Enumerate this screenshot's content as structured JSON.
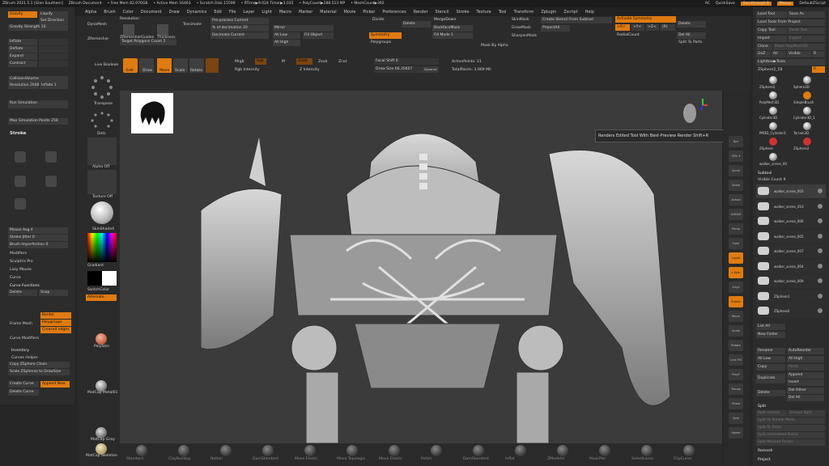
{
  "title_bar": {
    "app": "ZBrush 2021.5.1 [Glen Southern]",
    "doc": "ZBrush Document",
    "free_mem": "• Free Mem 82.076GB",
    "active_mem": "• Active Mem 16463",
    "scratch": "• Scratch Disk 15599",
    "ztime": "• RTime▶9.024 Timer▶3.035",
    "poly": "• PolyCount▶288.513 MP",
    "mesh": "• MeshCount▶392",
    "ac": "AC",
    "quicksave": "QuickSave",
    "seethrough": "See-through 0",
    "menus": "Menus",
    "script": "DefaultZScript"
  },
  "menu": [
    "Alpha",
    "Brush",
    "Color",
    "Document",
    "Draw",
    "Dynamics",
    "Edit",
    "File",
    "Layer",
    "Light",
    "Macro",
    "Marker",
    "Material",
    "Movie",
    "Picker",
    "Preferences",
    "Render",
    "Stencil",
    "Stroke",
    "Texture",
    "Tool",
    "Transform",
    "Zplugin",
    "Zscript",
    "Help"
  ],
  "left_top": {
    "gravity": "Gravity",
    "liquify": "Liquify",
    "set_direction": "Set Direction",
    "gravity_strength": "Gravity Strength 10",
    "inflate": "Inflate",
    "deflate": "Deflate",
    "expand": "Expand",
    "contract": "Contract",
    "collision_volume": "CollisionVolume",
    "resolution": "Resolution 2048",
    "inflate1": "Inflate 1",
    "run_sim": "Run Simulation",
    "max_points": "Max Simulation Points 250"
  },
  "stroke": {
    "header": "Stroke",
    "mouse_avg": "Mouse Avg 4",
    "stroke_jitter": "Stroke Jitter 0",
    "brush_imp": "Brush Imperfection 0",
    "modifiers": "Modifiers",
    "sculptris": "Sculptris Pro",
    "lazy": "Lazy Mouse",
    "curve": "Curve",
    "curve_functions": "Curve Functions",
    "delete": "Delete",
    "snap": "Snap",
    "border": "Border",
    "polygroups": "Polygroups",
    "creased": "Creased edges",
    "frame_mesh": "Frame Mesh",
    "curve_mod": "Curve Modifiers",
    "inventory": "Inventory",
    "curves_helper": "Curves Helper",
    "copy_chain": "Copy ZSphere Chain",
    "scale_draw": "Scale ZSpheres to DrawSize",
    "create_curve": "Create Curve",
    "append_new": "Append New",
    "delete_curve": "Delete Curve"
  },
  "left_col": {
    "live_boolean": "Live Boolean",
    "transpose": "Transpose",
    "dots": "Dots",
    "alpha_off": "Alpha Off",
    "texture_off": "Texture Off",
    "skinshade": "SkinShade4",
    "gradient": "Gradient",
    "switchcolor": "SwitchColor",
    "alternate": "Alternate",
    "polyskin": "PolySkin",
    "matcap_metal": "MatCap Metal01",
    "matcap_gray": "MatCap Gray",
    "matcap_skeleton": "MatCap Skeleton"
  },
  "top_shelf": {
    "dynamesh": "DynaMesh",
    "zremesher": "ZRemesher",
    "resolution": "Resolution",
    "zremeshguides": "ZRemesherGuides",
    "thickness": "Thickness",
    "tessimate": "Tessimate",
    "preprocess": "Pre-process Current",
    "pct_decimation": "% of decimation 20",
    "decimate": "Decimate Current",
    "target_poly": "Target Polygons Count 5",
    "mirror": "Mirror",
    "all_low": "All Low",
    "all_high": "All High",
    "fill_object": "Fill Object",
    "divide": "Divide",
    "delete": "Delete",
    "merge_down": "MergeDown",
    "backface": "BackfaceMask",
    "fill_mode": "Fill Mode 1",
    "projection": "ProjectAll",
    "symmetry": "Symmetry",
    "polygroups": "Polygroups",
    "mask_by_alpha": "Mask By Alpha",
    "skinmask": "SkinMask",
    "growmask": "GrowMask",
    "sharpenmask": "SharpenMask",
    "create_stencil": "Create Stencil From Subtool",
    "activate_sym": "Activate Symmetry",
    "x": ">X<",
    "y": ">Y<",
    "z": ">Z<",
    "r": "(R)",
    "radial": "RadialCount",
    "del_all": "Del All",
    "split_to_parts": "Split To Parts",
    "edit": "Edit",
    "draw": "Draw",
    "move": "Move",
    "scale": "Scale",
    "rotate": "Rotate",
    "mrgb": "Mrgb",
    "rgb": "Rgb",
    "m": "M",
    "zadd": "Zadd",
    "zsub": "Zsub",
    "zcut": "Zcut",
    "rgb_intensity": "Rgb Intensity",
    "z_intensity": "Z Intensity",
    "focal_shift": "Focal Shift 0",
    "draw_size": "Draw Size 66.35607",
    "dynamic": "Dynamic",
    "active_points": "ActivePoints: 21",
    "total_points": "TotalPoints: 3.969 Mil"
  },
  "tooltip": "Renders Edited Tool With Best-Preview Render  Shift+R",
  "right_tool": {
    "load_tool": "Load Tool",
    "save_as": "Save As",
    "load_from_project": "Load Tools From Project",
    "copy_tool": "Copy Tool",
    "paste_tool": "Paste Tool",
    "import": "Import",
    "export": "Export",
    "clone": "Clone",
    "make_polymesh": "Make PolyMesh3D",
    "goz": "GoZ",
    "all": "All",
    "visible": "Visible",
    "r": "R",
    "lightbox_tools": "Lightbox▶Tools",
    "zsphere": "ZSphere2_58",
    "r2": "R",
    "tools": [
      "ZSphere2",
      "Sphere3D",
      "PolyMesh3D",
      "SimpleBrush",
      "Cylinder3D",
      "Cylinder3D_1",
      "PM3D_Cylinder3",
      "Terrain3D",
      "ZSphere",
      "ZSphere2",
      "walker_scene_00"
    ],
    "subtool": "Subtool",
    "visible_count": "Visible Count 9",
    "subtools": [
      "walker_scene_003",
      "walker_scene_010",
      "walker_scene_006",
      "walker_scene_005",
      "walker_scene_007",
      "walker_scene_004",
      "walker_scene_009",
      "ZSphere1",
      "ZSphere2"
    ],
    "list_all": "List All",
    "new_folder": "New Folder",
    "rename": "Rename",
    "autoreorder": "AutoReorder",
    "all_low": "All Low",
    "all_high": "All High",
    "copy": "Copy",
    "paste": "Paste",
    "duplicate": "Duplicate",
    "append": "Append",
    "insert": "Insert",
    "delete": "Delete",
    "del_other": "Del Other",
    "del_all": "Del All",
    "split": "Split",
    "split_hidden": "Split Hidden",
    "groups_split": "Groups Split",
    "split_similar": "Split To Similar Parts",
    "split_parts": "Split To Parts",
    "split_unmasked": "Split Unmasked Points",
    "split_masked": "Split Masked Points",
    "remesh": "Remesh",
    "project": "Project"
  },
  "right_shelf": [
    "Bpr",
    "SPix 3",
    "Scroll",
    "Zoom",
    "Actual",
    "AAHalf",
    "Persp",
    "Floor",
    "Local",
    "L.Sym",
    "Gxyz",
    "Frame",
    "Move",
    "Scale",
    "Rotate",
    "Line Fill",
    "PolyF",
    "Transp",
    "Ghost",
    "Solo",
    "Xpose"
  ],
  "bottom_brushes": [
    "Standard",
    "ClayBuildup",
    "Nation",
    "DamStandard",
    "Move Elastic",
    "Move Topologic",
    "Move Elastic",
    "Polish",
    "DamStandard",
    "Inflat",
    "ZModeler",
    "MaskPen",
    "SelectLasso",
    "ClipCurve"
  ],
  "colors": {
    "orange": "#e07b11",
    "canvas": "#3b3b3b",
    "panel": "#303030"
  }
}
